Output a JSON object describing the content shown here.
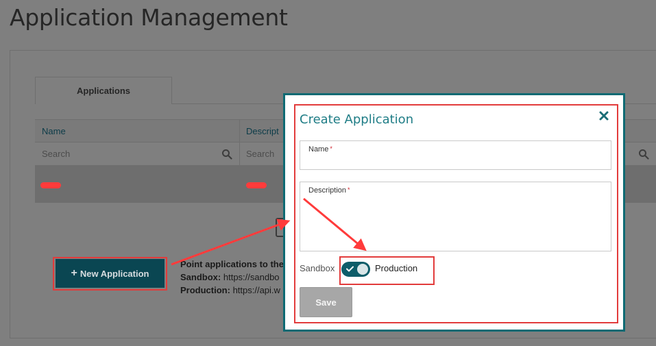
{
  "page": {
    "title": "Application Management"
  },
  "tabs": [
    {
      "label": "Applications",
      "active": true
    }
  ],
  "table": {
    "columns": [
      "Name",
      "Descript"
    ],
    "search_placeholder": "Search"
  },
  "toolbar": {
    "new_app_label": "New Application"
  },
  "endpoints": {
    "intro": "Point applications to the",
    "sandbox_label": "Sandbox:",
    "sandbox_url": "https://sandbo",
    "production_label": "Production:",
    "production_url": "https://api.w"
  },
  "modal": {
    "title": "Create Application",
    "name_label": "Name",
    "description_label": "Description",
    "required_mark": "*",
    "name_value": "",
    "description_value": "",
    "environment": {
      "left_label": "Sandbox",
      "right_label": "Production",
      "selected": "Production"
    },
    "save_label": "Save"
  },
  "colors": {
    "accent": "#0e6a73",
    "toggle_on": "#0e5d69",
    "annotation": "#e23b3b",
    "overlay": "#7f7f7f"
  },
  "icons": [
    "search-icon",
    "close-icon",
    "plus-icon",
    "check-icon"
  ]
}
